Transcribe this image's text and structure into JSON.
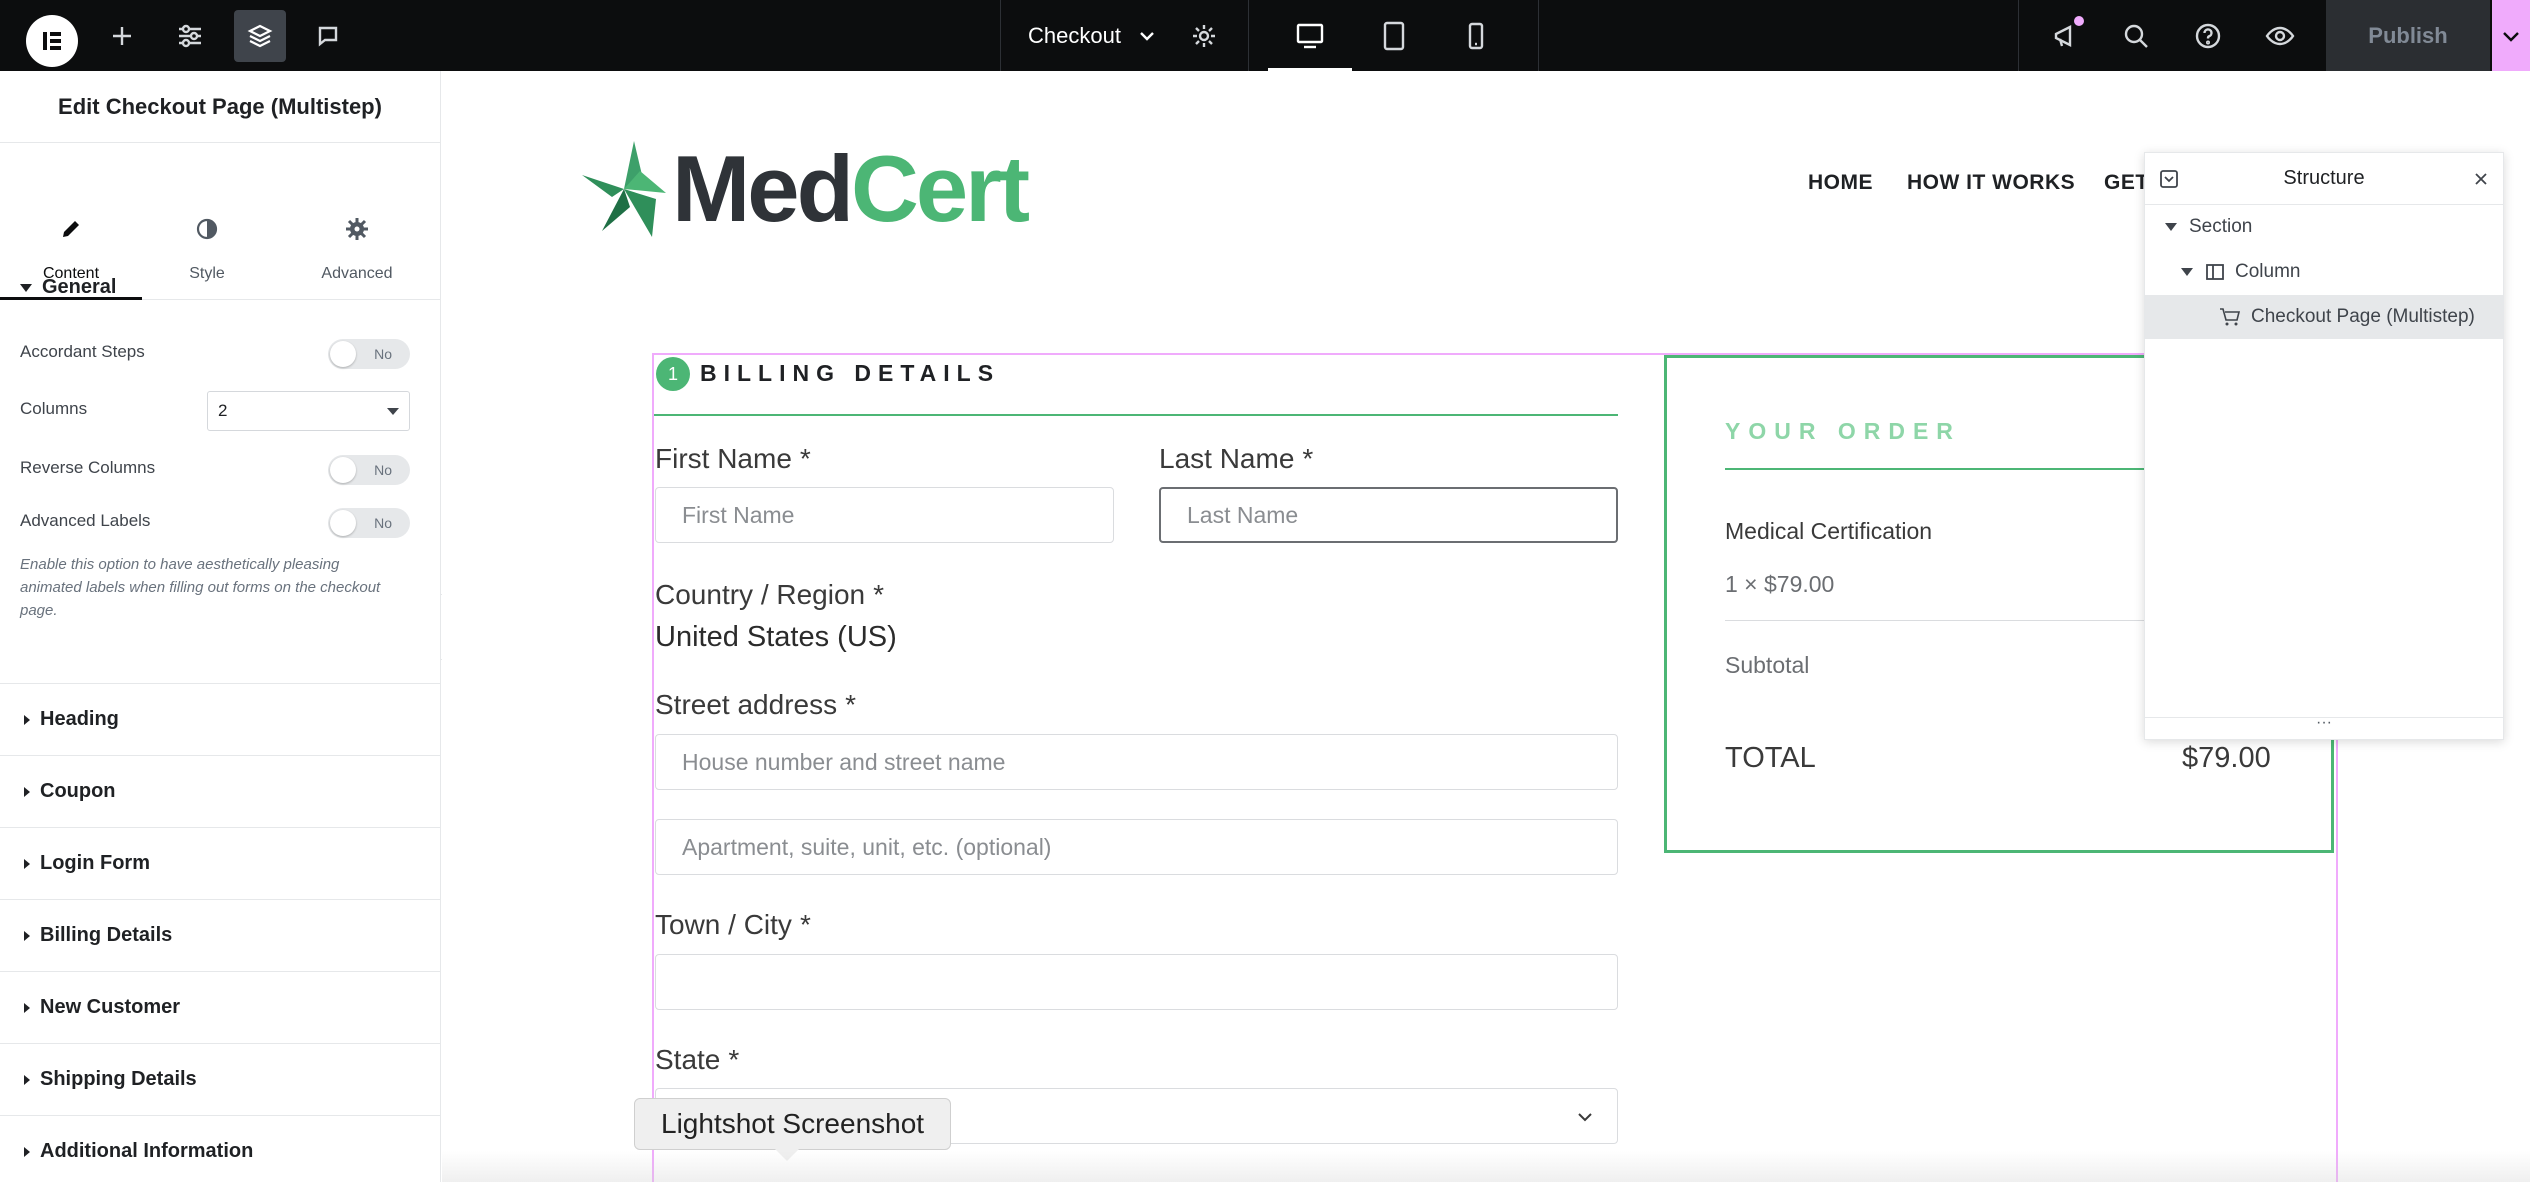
{
  "topbar": {
    "page_name": "Checkout",
    "publish_label": "Publish"
  },
  "panel": {
    "title": "Edit Checkout Page (Multistep)",
    "tabs": [
      {
        "label": "Content",
        "icon": "pencil-icon"
      },
      {
        "label": "Style",
        "icon": "contrast-icon"
      },
      {
        "label": "Advanced",
        "icon": "gear-icon"
      }
    ],
    "general": {
      "heading": "General",
      "accordant_steps": {
        "label": "Accordant Steps",
        "value": "No"
      },
      "columns": {
        "label": "Columns",
        "value": "2"
      },
      "reverse_columns": {
        "label": "Reverse Columns",
        "value": "No"
      },
      "advanced_labels": {
        "label": "Advanced Labels",
        "value": "No"
      },
      "description": "Enable this option to have aesthetically pleasing animated labels when filling out forms on the checkout page."
    },
    "sections": [
      "Heading",
      "Coupon",
      "Login Form",
      "Billing Details",
      "New Customer",
      "Shipping Details",
      "Additional Information"
    ]
  },
  "site": {
    "brand_part1": "Med",
    "brand_part2": "Cert",
    "nav": [
      "HOME",
      "HOW IT WORKS",
      "GET"
    ],
    "brand_colors": {
      "green": "#4cb675",
      "dark": "#2f3338"
    }
  },
  "billing": {
    "step": "1",
    "title": "BILLING DETAILS",
    "first_name": {
      "label": "First Name",
      "required": "*",
      "placeholder": "First Name"
    },
    "last_name": {
      "label": "Last Name",
      "required": "*",
      "placeholder": "Last Name"
    },
    "country": {
      "label": "Country / Region",
      "required": "*",
      "value": "United States (US)"
    },
    "street": {
      "label": "Street address",
      "required": "*",
      "placeholder1": "House number and street name",
      "placeholder2": "Apartment, suite, unit, etc. (optional)"
    },
    "city": {
      "label": "Town / City",
      "required": "*"
    },
    "state": {
      "label": "State",
      "required": "*"
    }
  },
  "order": {
    "title": "YOUR ORDER",
    "product": "Medical Certification",
    "qty_price": "1 ×  $79.00",
    "subtotal_label": "Subtotal",
    "total_label": "TOTAL",
    "total_value": "$79.00"
  },
  "structure": {
    "title": "Structure",
    "items": [
      "Section",
      "Column",
      "Checkout Page (Multistep)"
    ]
  },
  "tooltip": "Lightshot Screenshot"
}
